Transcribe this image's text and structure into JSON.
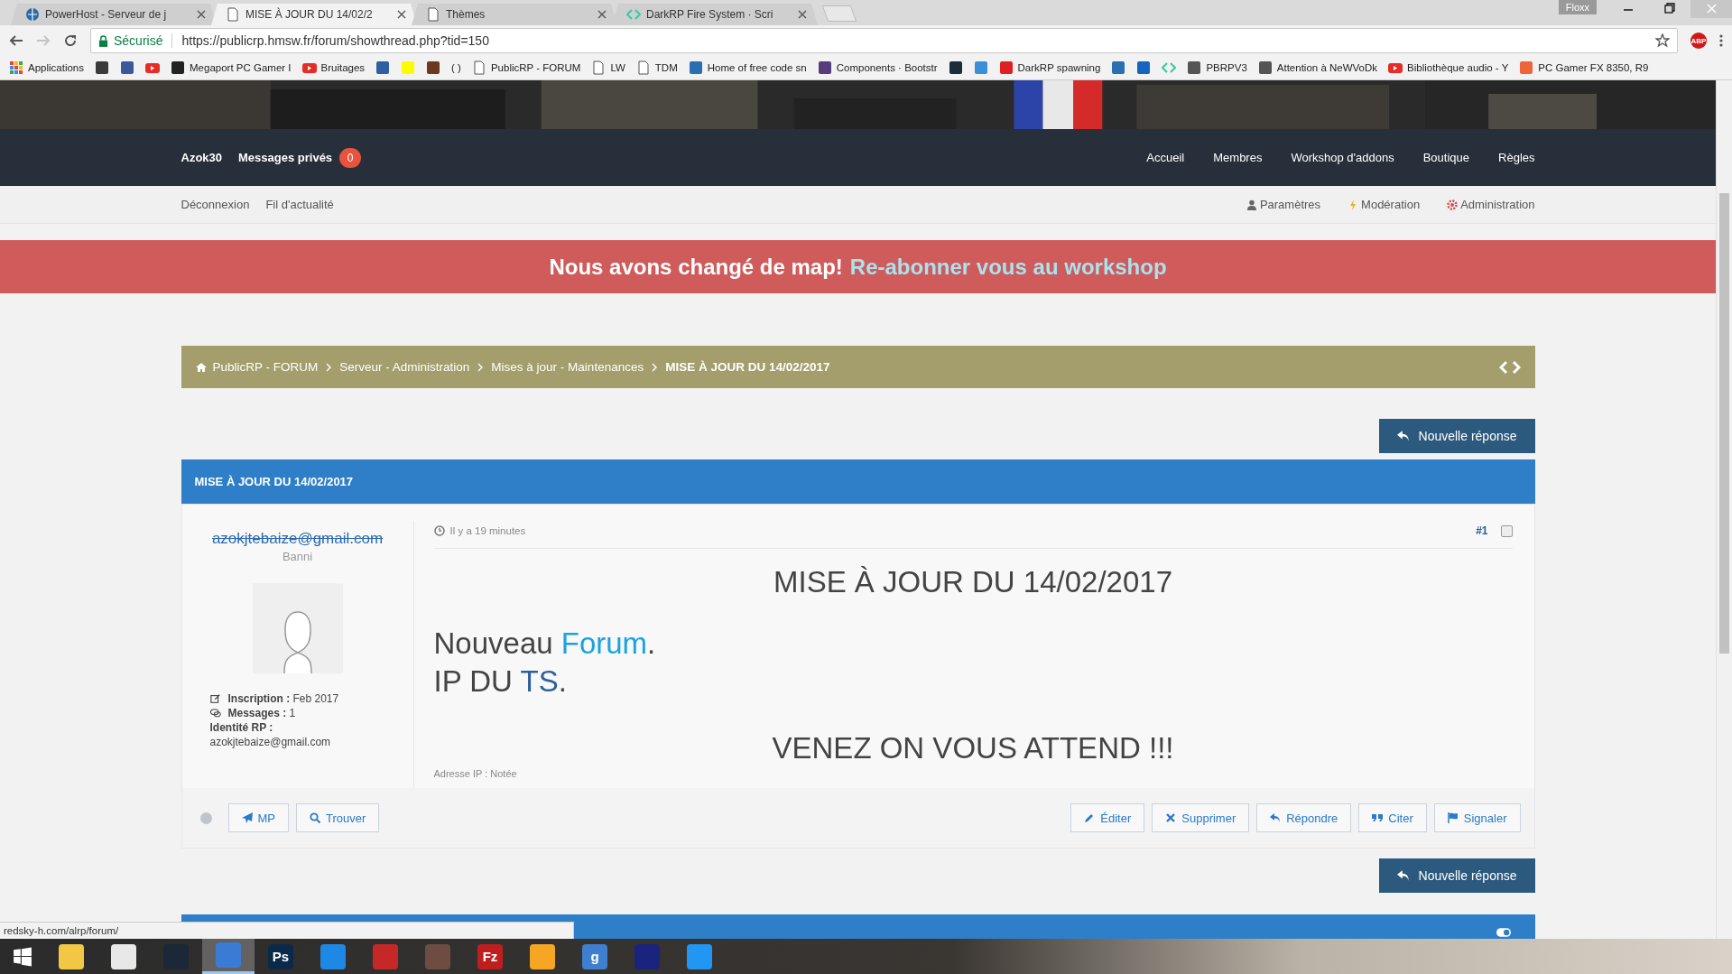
{
  "browser": {
    "tabs": [
      {
        "title": "PowerHost - Serveur de j",
        "kind": "globe",
        "selected": false
      },
      {
        "title": "MISE À JOUR DU 14/02/2",
        "kind": "page",
        "selected": true
      },
      {
        "title": "Thèmes",
        "kind": "page",
        "selected": false
      },
      {
        "title": "DarkRP Fire System · Scri",
        "kind": "code",
        "selected": false
      }
    ],
    "profile": "Floxx",
    "forward_disabled": true,
    "secure_label": "Sécurisé",
    "url": "https://publicrp.hmsw.fr/forum/showthread.php?tid=150",
    "extension_badge": "ABP",
    "bookmarks": [
      {
        "label": "Applications",
        "kind": "apps"
      },
      {
        "kind": "site",
        "color": "#3a3a3a"
      },
      {
        "kind": "site",
        "color": "#3b5998"
      },
      {
        "kind": "play"
      },
      {
        "label": "Megaport PC Gamer I",
        "kind": "site",
        "color": "#222222"
      },
      {
        "label": "Bruitages",
        "kind": "play"
      },
      {
        "kind": "site",
        "color": "#2f5f9e"
      },
      {
        "kind": "site",
        "color": "#fffc00"
      },
      {
        "kind": "site",
        "color": "#6b3a1e"
      },
      {
        "label": "( )",
        "kind": "text"
      },
      {
        "label": "PublicRP - FORUM",
        "kind": "page"
      },
      {
        "label": "LW",
        "kind": "page"
      },
      {
        "label": "TDM",
        "kind": "page"
      },
      {
        "label": "Home of free code sn",
        "kind": "site",
        "color": "#2a6fb0"
      },
      {
        "label": "Components · Bootstr",
        "kind": "site",
        "color": "#563d7c"
      },
      {
        "kind": "site",
        "color": "#1d2b3a"
      },
      {
        "kind": "site",
        "color": "#3b8fd9"
      },
      {
        "label": "DarkRP spawning",
        "kind": "site",
        "color": "#e02020"
      },
      {
        "kind": "site",
        "color": "#2a6fb0"
      },
      {
        "kind": "site",
        "color": "#1565c0"
      },
      {
        "kind": "code"
      },
      {
        "label": "PBRPV3",
        "kind": "site",
        "color": "#555555"
      },
      {
        "label": "Attention à NeWVoDk",
        "kind": "site",
        "color": "#555555"
      },
      {
        "label": "Bibliothèque audio - Y",
        "kind": "play"
      },
      {
        "label": "PC Gamer FX 8350, R9",
        "kind": "site",
        "color": "#f0643c"
      }
    ],
    "status_url": "redsky-h.com/alrp/forum/"
  },
  "nav": {
    "user": "Azok30",
    "messages_label": "Messages privés",
    "messages_count": "0",
    "links": [
      "Accueil",
      "Membres",
      "Workshop d'addons",
      "Boutique",
      "Règles"
    ]
  },
  "subnav": {
    "left": [
      "Déconnexion",
      "Fil d'actualité"
    ],
    "right": [
      {
        "label": "Paramètres",
        "kind": "user"
      },
      {
        "label": "Modération",
        "kind": "bolt"
      },
      {
        "label": "Administration",
        "kind": "gear"
      }
    ]
  },
  "banner": {
    "text": "Nous avons changé de map!",
    "link": "Re-abonner vous au workshop"
  },
  "breadcrumb": [
    {
      "label": "PublicRP - FORUM",
      "current": false
    },
    {
      "label": "Serveur - Administration",
      "current": false
    },
    {
      "label": "Mises à jour - Maintenances",
      "current": false
    },
    {
      "label": "MISE À JOUR DU 14/02/2017",
      "current": true
    }
  ],
  "new_reply_button": "Nouvelle réponse",
  "thread_title": "MISE À JOUR DU 14/02/2017",
  "post": {
    "author": "azokjtebaize@gmail.com",
    "banned": true,
    "rank": "Banni",
    "online": false,
    "info": [
      {
        "label": "Inscription :",
        "value": "Feb 2017",
        "kind": "edit"
      },
      {
        "label": "Messages :",
        "value": "1",
        "kind": "comments"
      },
      {
        "label": "Identité RP :",
        "value": "azokjtebaize@gmail.com",
        "kind": "plain"
      }
    ],
    "time": "Il y a 19 minutes",
    "number": "#1",
    "selected": false,
    "lines": [
      {
        "kind": "centered",
        "parts": [
          {
            "text": "MISE À JOUR DU 14/02/2017"
          }
        ]
      },
      {
        "kind": "plain",
        "parts": [
          {
            "text": "Nouveau "
          },
          {
            "text": "Forum",
            "color": "#1aa3e0"
          },
          {
            "text": "."
          }
        ]
      },
      {
        "kind": "plain",
        "parts": [
          {
            "text": "IP DU "
          },
          {
            "text": "TS",
            "color": "#2e5f9c"
          },
          {
            "text": "."
          }
        ]
      },
      {
        "kind": "centered",
        "parts": [
          {
            "text": "VENEZ ON VOUS ATTEND !!!"
          }
        ]
      }
    ],
    "signature": "Adresse IP : Notée",
    "left_buttons": [
      {
        "label": "MP",
        "kind": "send"
      },
      {
        "label": "Trouver",
        "kind": "search"
      }
    ],
    "right_buttons": [
      {
        "label": "Éditer",
        "kind": "pencil"
      },
      {
        "label": "Supprimer",
        "kind": "x"
      },
      {
        "label": "Répondre",
        "kind": "reply"
      },
      {
        "label": "Citer",
        "kind": "quote"
      },
      {
        "label": "Signaler",
        "kind": "flag"
      }
    ]
  },
  "new_reply_button_bottom": "Nouvelle réponse",
  "taskbar": {
    "apps": [
      {
        "color": "#f2c744",
        "active": false
      },
      {
        "color": "#e8e8e8",
        "active": false
      },
      {
        "color": "#1b2838",
        "active": false
      },
      {
        "color": "#3a7bd5",
        "active": true
      },
      {
        "color": "#0b2a4a",
        "label": "Ps",
        "active": false
      },
      {
        "color": "#1e88e5",
        "active": false
      },
      {
        "color": "#c62828",
        "active": false
      },
      {
        "color": "#6d4c41",
        "active": false
      },
      {
        "color": "#bf1e1e",
        "label": "Fz",
        "active": false
      },
      {
        "color": "#f5a623",
        "active": false
      },
      {
        "color": "#3f7fd0",
        "label": "g",
        "active": false
      },
      {
        "color": "#1a237e",
        "active": false
      },
      {
        "color": "#2196f3",
        "active": false
      }
    ]
  }
}
